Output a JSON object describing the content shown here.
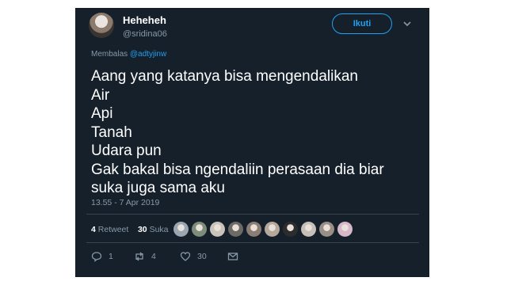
{
  "author": {
    "display_name": "Heheheh",
    "handle": "@sridina06"
  },
  "follow_label": "Ikuti",
  "reply": {
    "prefix": "Membalas ",
    "mention": "@adtyjinw"
  },
  "tweet_lines": [
    "Aang yang katanya bisa mengendalikan",
    "Air",
    "Api",
    "Tanah",
    "Udara pun",
    "Gak bakal bisa ngendaliin perasaan dia biar",
    "suka juga sama aku"
  ],
  "timestamp": "13.55 - 7 Apr 2019",
  "stats": {
    "retweet_count": "4",
    "retweet_label": "Retweet",
    "like_count": "30",
    "like_label": "Suka"
  },
  "liker_avatar_colors": [
    "#9aa6b2",
    "#7e8c7a",
    "#c9c3b8",
    "#6d6a66",
    "#8a7d74",
    "#b5a99c",
    "#2c2c2c",
    "#c8bfb6",
    "#9a8f86",
    "#d7b8c8"
  ],
  "actions": {
    "reply_count": "1",
    "retweet_count": "4",
    "like_count": "30"
  },
  "icons": [
    "chevron-down-icon",
    "reply-icon",
    "retweet-icon",
    "heart-icon",
    "envelope-icon"
  ],
  "colors": {
    "background": "#15202b",
    "accent": "#1da1f2",
    "muted": "#8899a6"
  }
}
